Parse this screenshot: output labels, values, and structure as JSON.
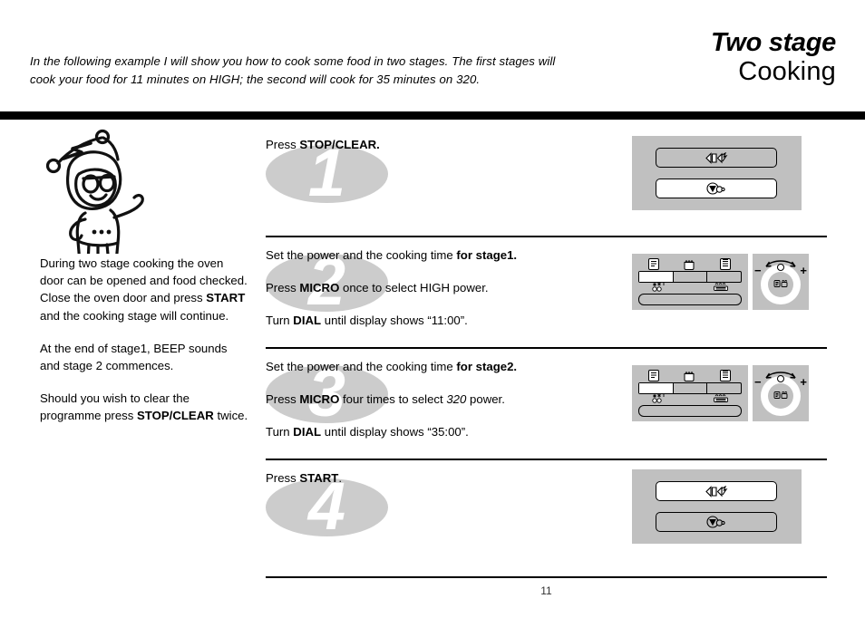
{
  "header": {
    "intro": "In the following example I will show you how to cook some food in two stages. The first stages will cook your food for 11 minutes on HIGH; the second will cook for 35 minutes on 320.",
    "title_line1": "Two stage",
    "title_line2": "Cooking"
  },
  "sidebar": {
    "mascot_name": "robot-mascot-illustration",
    "paragraphs": [
      "During two stage cooking the oven door can be opened and food checked. Close the oven door and press START and the cooking stage will continue.",
      "At the end of stage1, BEEP sounds and stage 2 commences.",
      "Should you wish to clear the programme press STOP/CLEAR twice."
    ],
    "p1_pre": "During two stage cooking the oven door can be opened and food checked. Close the oven door and press ",
    "p1_bold": "START",
    "p1_post": " and the cooking stage will continue.",
    "p2": "At the end of stage1, BEEP sounds and stage 2 commences.",
    "p3_pre": "Should you wish to clear the programme press ",
    "p3_bold": "STOP/CLEAR",
    "p3_post": " twice."
  },
  "steps": [
    {
      "number": "1",
      "lines": [
        {
          "pre": "Press ",
          "bold": "STOP/CLEAR.",
          "post": ""
        }
      ],
      "panel": {
        "type": "buttons",
        "top_button": {
          "icon": "stop-clear-icon",
          "state": "plain"
        },
        "bottom_button": {
          "icon": "start-icon",
          "state": "filled"
        }
      }
    },
    {
      "number": "2",
      "lines": [
        {
          "pre": "Set the power and the cooking time ",
          "bold": "for stage1.",
          "post": ""
        },
        {
          "pre": "Press ",
          "bold": "MICRO",
          "post": " once to select HIGH power."
        },
        {
          "pre": "Turn ",
          "bold": "DIAL",
          "post": " until display shows “11:00”."
        }
      ],
      "panel": {
        "type": "controls",
        "top_icons": [
          "menu-list-icon",
          "pot-icon",
          "menu-grid-icon"
        ],
        "segments": [
          "active",
          "plain",
          "plain"
        ],
        "bottom_icons": [
          "defrost-icon",
          "grill-icon"
        ],
        "dial": {
          "minus": "−",
          "plus": "+",
          "center_label": "micro-dial-icon"
        }
      }
    },
    {
      "number": "3",
      "lines": [
        {
          "pre": "Set the power and the cooking time ",
          "bold": "for stage2.",
          "post": ""
        },
        {
          "pre": "Press ",
          "bold": "MICRO",
          "post": " four times to select ",
          "italic": "320",
          "tail": " power."
        },
        {
          "pre": "Turn ",
          "bold": "DIAL",
          "post": " until display shows “35:00”."
        }
      ],
      "panel": {
        "type": "controls",
        "top_icons": [
          "menu-list-icon",
          "pot-icon",
          "menu-grid-icon"
        ],
        "segments": [
          "active",
          "plain",
          "plain"
        ],
        "bottom_icons": [
          "defrost-icon",
          "grill-icon"
        ],
        "dial": {
          "minus": "−",
          "plus": "+",
          "center_label": "micro-dial-icon"
        }
      }
    },
    {
      "number": "4",
      "lines": [
        {
          "pre": "Press ",
          "bold": "START",
          "post": "."
        }
      ],
      "panel": {
        "type": "buttons",
        "top_button": {
          "icon": "stop-clear-icon",
          "state": "filled"
        },
        "bottom_button": {
          "icon": "start-icon",
          "state": "plain"
        }
      }
    }
  ],
  "footer": {
    "page_number": "11"
  },
  "colors": {
    "ellipse_gray": "#cccccc",
    "panel_gray": "#c0c0c0",
    "rule_black": "#000000"
  }
}
